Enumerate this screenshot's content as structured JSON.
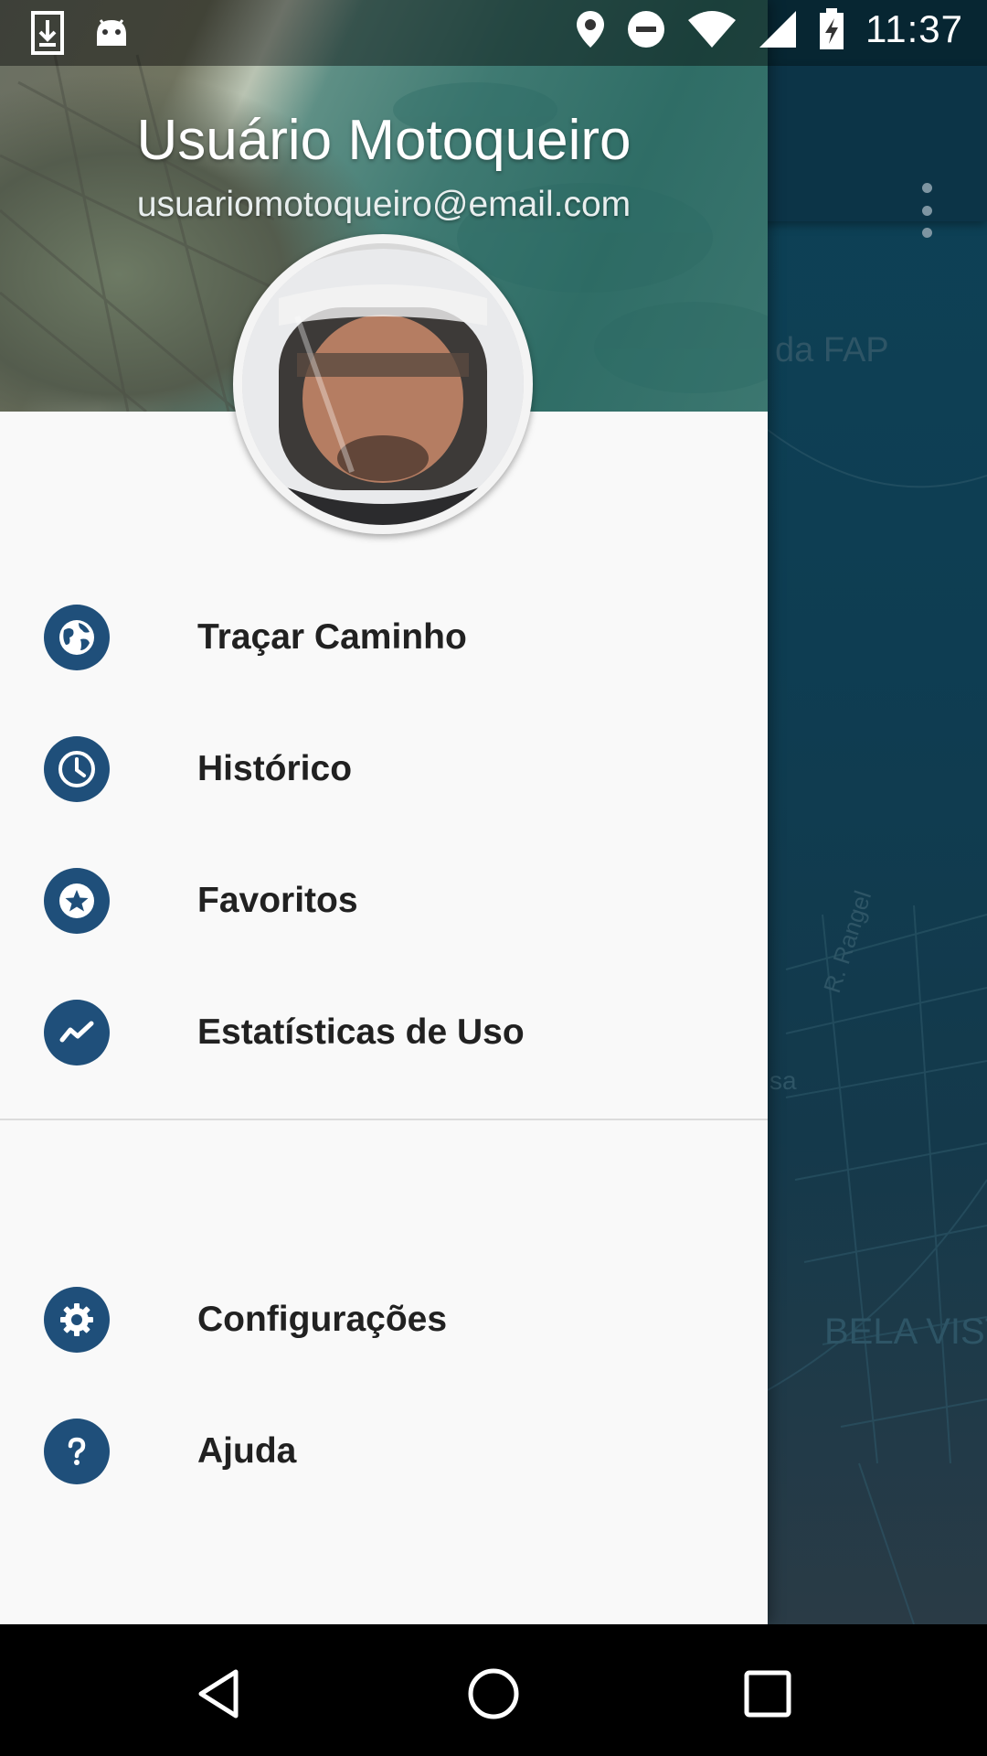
{
  "status_bar": {
    "time": "11:37",
    "left_icons": [
      "download-icon",
      "android-icon"
    ],
    "right_icons": [
      "location-icon",
      "do-not-disturb-icon",
      "wifi-icon",
      "signal-icon",
      "battery-charging-icon"
    ]
  },
  "drawer": {
    "user_name": "Usuário Motoqueiro",
    "user_email": "usuariomotoqueiro@email.com",
    "primary_items": [
      {
        "label": "Traçar Caminho",
        "icon": "globe-icon"
      },
      {
        "label": "Histórico",
        "icon": "clock-icon"
      },
      {
        "label": "Favoritos",
        "icon": "star-icon"
      },
      {
        "label": "Estatísticas de Uso",
        "icon": "trending-icon"
      }
    ],
    "secondary_items": [
      {
        "label": "Configurações",
        "icon": "gear-icon"
      },
      {
        "label": "Ajuda",
        "icon": "help-icon"
      }
    ]
  },
  "map": {
    "labels": [
      "da FAP",
      "R. Rangel",
      "sa",
      "BELA VIST"
    ]
  },
  "colors": {
    "drawer_bg": "#f9f9f9",
    "icon_circle": "#1f4f7a",
    "toolbar": "#0c3447",
    "map": "#0e3d52"
  },
  "nav_bar": [
    "back-icon",
    "home-icon",
    "recents-icon"
  ]
}
